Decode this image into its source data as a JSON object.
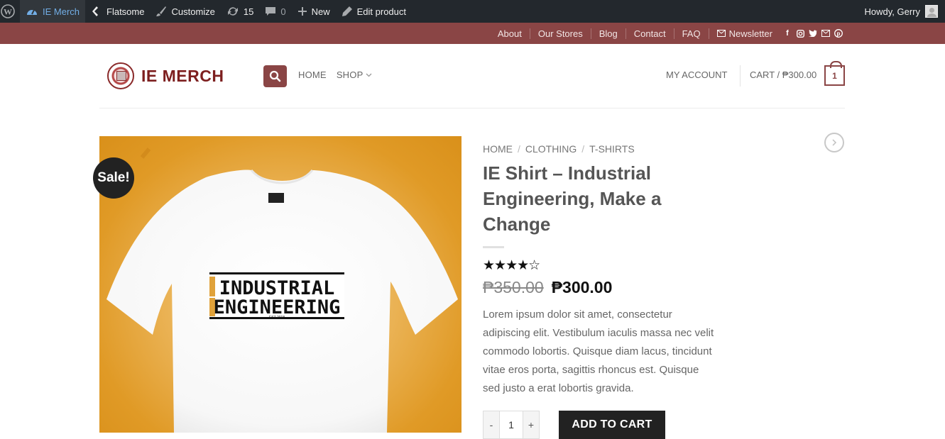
{
  "adminbar": {
    "site_name": "IE Merch",
    "theme": "Flatsome",
    "customize": "Customize",
    "updates_count": "15",
    "comments_count": "0",
    "new_label": "New",
    "edit_label": "Edit product",
    "howdy": "Howdy, Gerry"
  },
  "topbar": {
    "links": [
      "About",
      "Our Stores",
      "Blog",
      "Contact",
      "FAQ"
    ],
    "newsletter": "Newsletter",
    "social_icons": [
      "facebook-icon",
      "instagram-icon",
      "twitter-icon",
      "email-icon",
      "pinterest-icon"
    ]
  },
  "header": {
    "logo_text": "IE MERCH",
    "nav": {
      "home": "HOME",
      "shop": "SHOP"
    },
    "account": "MY ACCOUNT",
    "cart_label": "CART / ₱300.00",
    "cart_count": "1"
  },
  "product": {
    "sale_badge": "Sale!",
    "breadcrumb": [
      "HOME",
      "CLOTHING",
      "T-SHIRTS"
    ],
    "breadcrumb_sep": "/",
    "title": "IE Shirt – Industrial Engineering, Make a Change",
    "rating_stars": "★★★★☆",
    "rating_value": 4,
    "rating_max": 5,
    "old_price": "₱350.00",
    "price": "₱300.00",
    "description": "Lorem ipsum dolor sit amet, consectetur adipiscing elit. Vestibulum iaculis massa nec velit commodo lobortis. Quisque diam lacus, tincidunt vitae eros porta, sagittis rhoncus est. Quisque sed justo a erat lobortis gravida.",
    "quantity": "1",
    "qty_minus": "-",
    "qty_plus": "+",
    "add_to_cart": "ADD TO CART",
    "shirt_print_line1": "INDUSTRIAL",
    "shirt_print_line2": "ENGINEERING",
    "shirt_print_est": "EST 2018"
  },
  "colors": {
    "brand": "#8a4545",
    "adminbar": "#23282d",
    "image_bg": "#e09a26"
  }
}
